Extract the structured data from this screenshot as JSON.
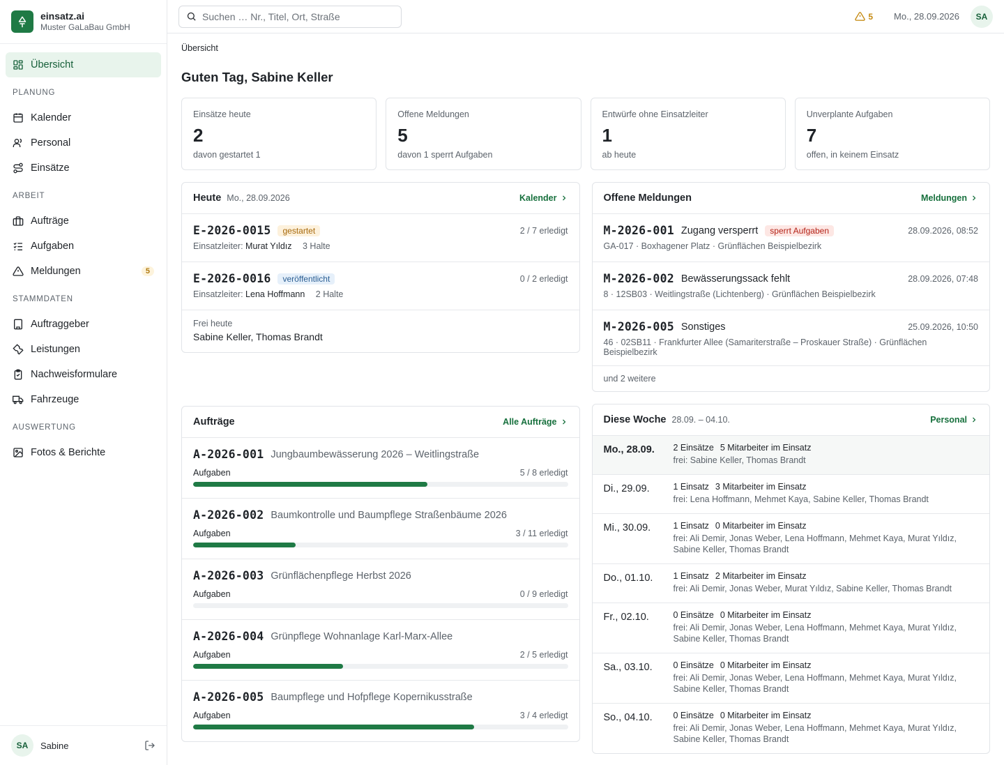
{
  "brand": {
    "name": "einsatz.ai",
    "company": "Muster GaLaBau GmbH"
  },
  "nav": {
    "overview": "Übersicht",
    "sections": {
      "planung": "PLANUNG",
      "arbeit": "ARBEIT",
      "stammdaten": "STAMMDATEN",
      "auswertung": "AUSWERTUNG"
    },
    "kalender": "Kalender",
    "personal": "Personal",
    "einsaetze": "Einsätze",
    "auftraege": "Aufträge",
    "aufgaben": "Aufgaben",
    "meldungen": "Meldungen",
    "meldungen_badge": "5",
    "auftraggeber": "Auftraggeber",
    "leistungen": "Leistungen",
    "nachweisformulare": "Nachweisformulare",
    "fahrzeuge": "Fahrzeuge",
    "fotos": "Fotos & Berichte"
  },
  "user": {
    "initials": "SA",
    "name": "Sabine"
  },
  "topbar": {
    "search_placeholder": "Suchen … Nr., Titel, Ort, Straße",
    "warning_count": "5",
    "date": "Mo., 28.09.2026",
    "avatar": "SA"
  },
  "colors": {
    "accent": "#1f7a45",
    "warning": "#c58a12"
  },
  "page": {
    "breadcrumb": "Übersicht",
    "greeting": "Guten Tag, Sabine Keller"
  },
  "stats": [
    {
      "label": "Einsätze heute",
      "value": "2",
      "sub": "davon gestartet 1"
    },
    {
      "label": "Offene Meldungen",
      "value": "5",
      "sub": "davon 1 sperrt Aufgaben"
    },
    {
      "label": "Entwürfe ohne Einsatzleiter",
      "value": "1",
      "sub": "ab heute"
    },
    {
      "label": "Unverplante Aufgaben",
      "value": "7",
      "sub": "offen, in keinem Einsatz"
    }
  ],
  "heute": {
    "title": "Heute",
    "date": "Mo., 28.09.2026",
    "link": "Kalender",
    "einsaetze": [
      {
        "code": "E-2026-0015",
        "status": "gestartet",
        "progress": "2 / 7 erledigt",
        "leader_label": "Einsatzleiter:",
        "leader": "Murat Yıldız",
        "stops": "3 Halte"
      },
      {
        "code": "E-2026-0016",
        "status": "veröffentlicht",
        "progress": "0 / 2 erledigt",
        "leader_label": "Einsatzleiter:",
        "leader": "Lena Hoffmann",
        "stops": "2 Halte"
      }
    ],
    "frei_label": "Frei heute",
    "frei_names": "Sabine Keller, Thomas Brandt"
  },
  "meldungen": {
    "title": "Offene Meldungen",
    "link": "Meldungen",
    "items": [
      {
        "code": "M-2026-001",
        "title": "Zugang versperrt",
        "badge": "sperrt Aufgaben",
        "time": "28.09.2026, 08:52",
        "location": "GA-017 · Boxhagener Platz · Grünflächen Beispielbezirk"
      },
      {
        "code": "M-2026-002",
        "title": "Bewässerungssack fehlt",
        "badge": "",
        "time": "28.09.2026, 07:48",
        "location": "8 · 12SB03 · Weitlingstraße (Lichtenberg) · Grünflächen Beispielbezirk"
      },
      {
        "code": "M-2026-005",
        "title": "Sonstiges",
        "badge": "",
        "time": "25.09.2026, 10:50",
        "location": "46 · 02SB11 · Frankfurter Allee (Samariterstraße – Proskauer Straße) · Grünflächen Beispielbezirk"
      }
    ],
    "more": "und 2 weitere"
  },
  "auftraege": {
    "title": "Aufträge",
    "link": "Alle Aufträge",
    "items": [
      {
        "code": "A-2026-001",
        "title": "Jungbaumbewässerung 2026 – Weitlingstraße",
        "label": "Aufgaben",
        "progress": "5 / 8 erledigt",
        "fraction": 0.625
      },
      {
        "code": "A-2026-002",
        "title": "Baumkontrolle und Baumpflege Straßenbäume 2026",
        "label": "Aufgaben",
        "progress": "3 / 11 erledigt",
        "fraction": 0.2727
      },
      {
        "code": "A-2026-003",
        "title": "Grünflächenpflege Herbst 2026",
        "label": "Aufgaben",
        "progress": "0 / 9 erledigt",
        "fraction": 0
      },
      {
        "code": "A-2026-004",
        "title": "Grünpflege Wohnanlage Karl-Marx-Allee",
        "label": "Aufgaben",
        "progress": "2 / 5 erledigt",
        "fraction": 0.4
      },
      {
        "code": "A-2026-005",
        "title": "Baumpflege und Hofpflege Kopernikusstraße",
        "label": "Aufgaben",
        "progress": "3 / 4 erledigt",
        "fraction": 0.75
      }
    ]
  },
  "woche": {
    "title": "Diese Woche",
    "range": "28.09. – 04.10.",
    "link": "Personal",
    "days": [
      {
        "day": "Mo., 28.09.",
        "einsaetze": "2 Einsätze",
        "mitarbeiter": "5 Mitarbeiter im Einsatz",
        "frei": "frei: Sabine Keller, Thomas Brandt"
      },
      {
        "day": "Di., 29.09.",
        "einsaetze": "1 Einsatz",
        "mitarbeiter": "3 Mitarbeiter im Einsatz",
        "frei": "frei: Lena Hoffmann, Mehmet Kaya, Sabine Keller, Thomas Brandt"
      },
      {
        "day": "Mi., 30.09.",
        "einsaetze": "1 Einsatz",
        "mitarbeiter": "0 Mitarbeiter im Einsatz",
        "frei": "frei: Ali Demir, Jonas Weber, Lena Hoffmann, Mehmet Kaya, Murat Yıldız, Sabine Keller, Thomas Brandt"
      },
      {
        "day": "Do., 01.10.",
        "einsaetze": "1 Einsatz",
        "mitarbeiter": "2 Mitarbeiter im Einsatz",
        "frei": "frei: Ali Demir, Jonas Weber, Murat Yıldız, Sabine Keller, Thomas Brandt"
      },
      {
        "day": "Fr., 02.10.",
        "einsaetze": "0 Einsätze",
        "mitarbeiter": "0 Mitarbeiter im Einsatz",
        "frei": "frei: Ali Demir, Jonas Weber, Lena Hoffmann, Mehmet Kaya, Murat Yıldız, Sabine Keller, Thomas Brandt"
      },
      {
        "day": "Sa., 03.10.",
        "einsaetze": "0 Einsätze",
        "mitarbeiter": "0 Mitarbeiter im Einsatz",
        "frei": "frei: Ali Demir, Jonas Weber, Lena Hoffmann, Mehmet Kaya, Murat Yıldız, Sabine Keller, Thomas Brandt"
      },
      {
        "day": "So., 04.10.",
        "einsaetze": "0 Einsätze",
        "mitarbeiter": "0 Mitarbeiter im Einsatz",
        "frei": "frei: Ali Demir, Jonas Weber, Lena Hoffmann, Mehmet Kaya, Murat Yıldız, Sabine Keller, Thomas Brandt"
      }
    ]
  }
}
